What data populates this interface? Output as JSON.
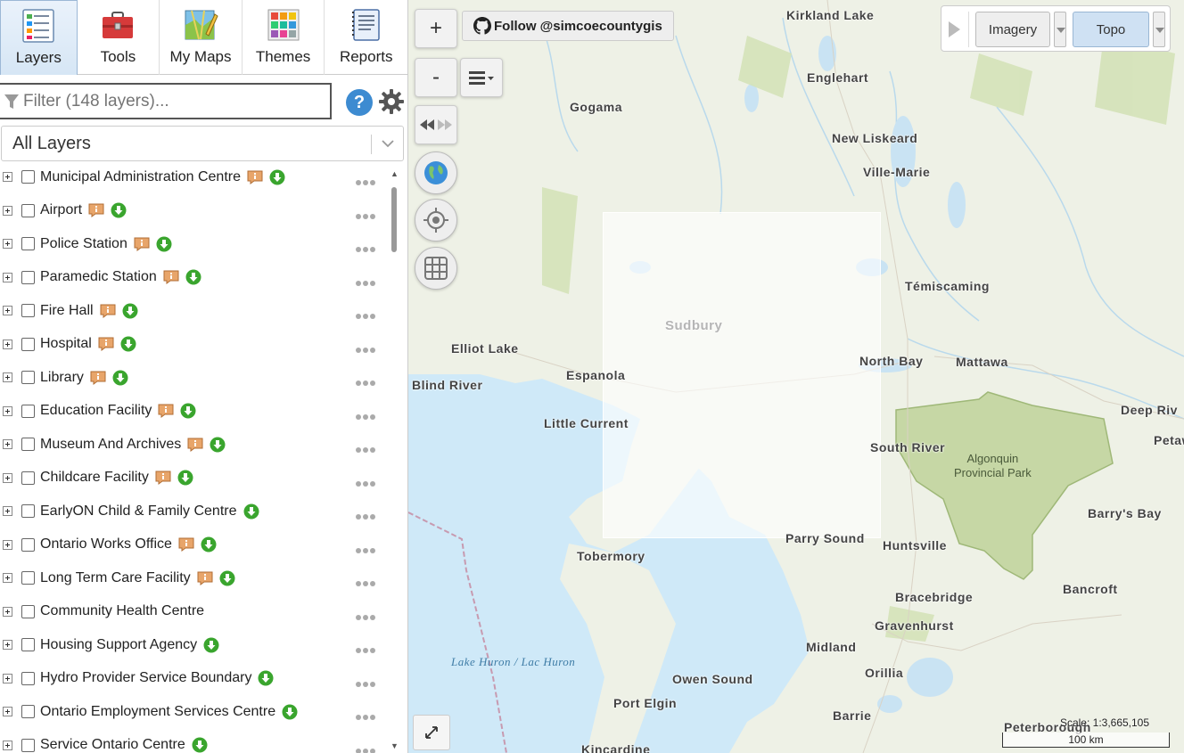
{
  "tabs": [
    {
      "label": "Layers",
      "icon": "layers-icon",
      "active": true
    },
    {
      "label": "Tools",
      "icon": "toolbox-icon",
      "active": false
    },
    {
      "label": "My Maps",
      "icon": "my-maps-icon",
      "active": false
    },
    {
      "label": "Themes",
      "icon": "themes-icon",
      "active": false
    },
    {
      "label": "Reports",
      "icon": "reports-icon",
      "active": false
    }
  ],
  "filter": {
    "placeholder": "Filter (148 layers)..."
  },
  "layer_select": {
    "selected": "All Layers"
  },
  "layers": [
    {
      "name": "Municipal Administration Centre",
      "info": true,
      "download": true
    },
    {
      "name": "Airport",
      "info": true,
      "download": true
    },
    {
      "name": "Police Station",
      "info": true,
      "download": true
    },
    {
      "name": "Paramedic Station",
      "info": true,
      "download": true
    },
    {
      "name": "Fire Hall",
      "info": true,
      "download": true
    },
    {
      "name": "Hospital",
      "info": true,
      "download": true
    },
    {
      "name": "Library",
      "info": true,
      "download": true
    },
    {
      "name": "Education Facility",
      "info": true,
      "download": true
    },
    {
      "name": "Museum And Archives",
      "info": true,
      "download": true
    },
    {
      "name": "Childcare Facility",
      "info": true,
      "download": true
    },
    {
      "name": "EarlyON Child & Family Centre",
      "info": false,
      "download": true
    },
    {
      "name": "Ontario Works Office",
      "info": true,
      "download": true
    },
    {
      "name": "Long Term Care Facility",
      "info": true,
      "download": true
    },
    {
      "name": "Community Health Centre",
      "info": false,
      "download": false
    },
    {
      "name": "Housing Support Agency",
      "info": false,
      "download": true
    },
    {
      "name": "Hydro Provider Service Boundary",
      "info": false,
      "download": true
    },
    {
      "name": "Ontario Employment Services Centre",
      "info": false,
      "download": true
    },
    {
      "name": "Service Ontario Centre",
      "info": false,
      "download": true
    }
  ],
  "map": {
    "zoom_in": "+",
    "zoom_out": "-",
    "follow_label": "Follow @simcoecountygis",
    "basemaps": {
      "imagery": "Imagery",
      "topo": "Topo",
      "active": "Topo"
    },
    "scale_text": "Scale: 1:3,665,105",
    "scale_bar": "100 km",
    "places": [
      {
        "name": "Kirkland Lake"
      },
      {
        "name": "Englehart"
      },
      {
        "name": "Gogama"
      },
      {
        "name": "New Liskeard"
      },
      {
        "name": "Ville-Marie"
      },
      {
        "name": "Témiscaming"
      },
      {
        "name": "Sudbury"
      },
      {
        "name": "Elliot Lake"
      },
      {
        "name": "Espanola"
      },
      {
        "name": "North Bay"
      },
      {
        "name": "Mattawa"
      },
      {
        "name": "Blind River"
      },
      {
        "name": "Little Current"
      },
      {
        "name": "South River"
      },
      {
        "name": "Deep Riv"
      },
      {
        "name": "Petaw"
      },
      {
        "name": "Barry's Bay"
      },
      {
        "name": "Parry Sound"
      },
      {
        "name": "Huntsville"
      },
      {
        "name": "Tobermory"
      },
      {
        "name": "Bracebridge"
      },
      {
        "name": "Bancroft"
      },
      {
        "name": "Gravenhurst"
      },
      {
        "name": "Midland"
      },
      {
        "name": "Orillia"
      },
      {
        "name": "Owen Sound"
      },
      {
        "name": "Port Elgin"
      },
      {
        "name": "Barrie"
      },
      {
        "name": "Peterborough"
      },
      {
        "name": "Kincardine"
      }
    ],
    "park_label": "Algonquin\nProvincial Park",
    "water_label": "Lake Huron / Lac Huron"
  },
  "colors": {
    "land": "#eef1e6",
    "water": "#cfe9f8",
    "park": "#c6d7a5",
    "accent": "#3d8bd1",
    "download": "#3aa52e",
    "info": "#e8a56a"
  }
}
